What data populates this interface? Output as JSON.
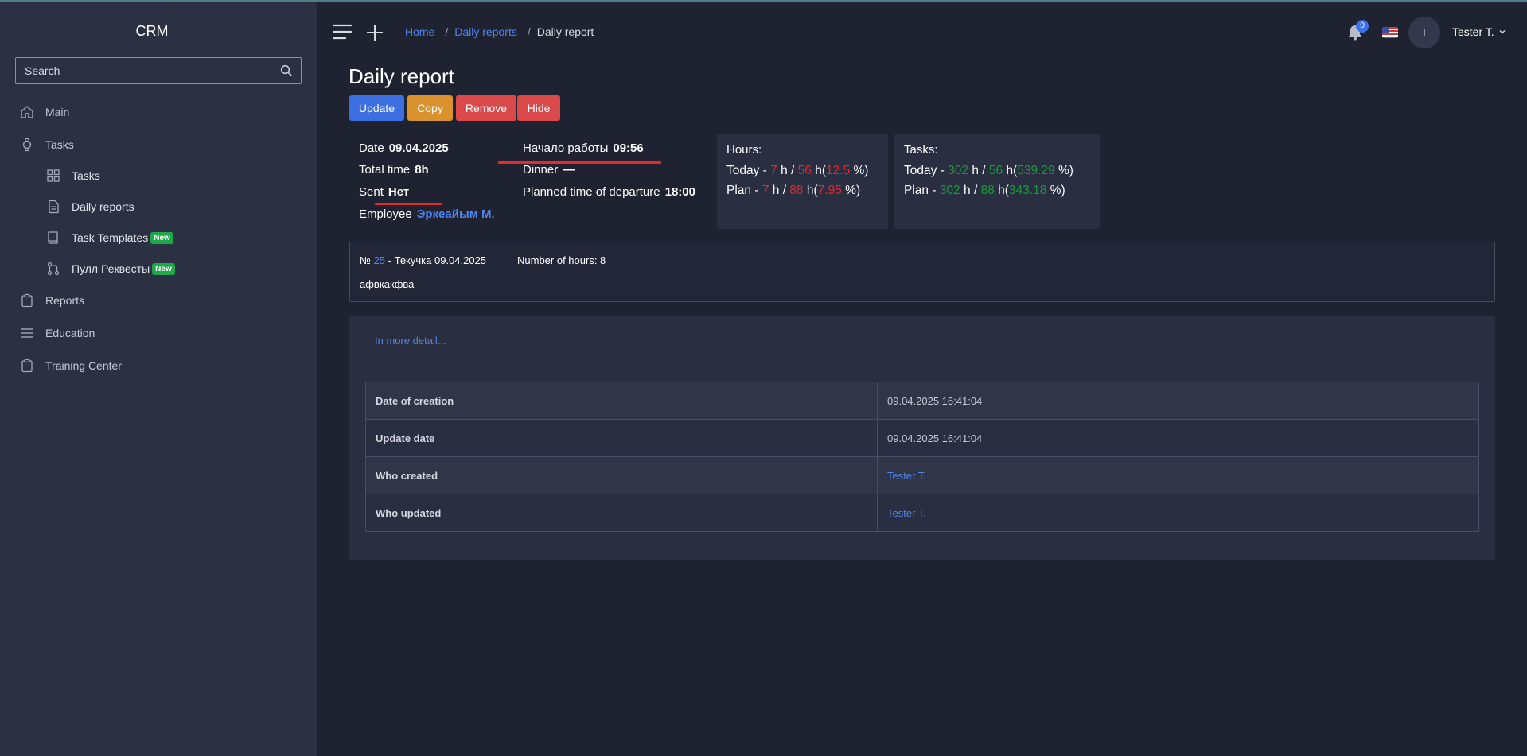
{
  "sidebar": {
    "brand": "CRM",
    "search_placeholder": "Search",
    "items": [
      {
        "label": "Main",
        "icon": "home-icon"
      },
      {
        "label": "Tasks",
        "icon": "watch-icon"
      },
      {
        "label": "Tasks",
        "icon": "grid-icon",
        "sub": true
      },
      {
        "label": "Daily reports",
        "icon": "document-icon",
        "sub": true
      },
      {
        "label": "Task Templates",
        "icon": "book-icon",
        "sub": true,
        "badge": "New"
      },
      {
        "label": "Пулл Реквесты",
        "icon": "pull-request-icon",
        "sub": true,
        "badge": "New"
      },
      {
        "label": "Reports",
        "icon": "clipboard-icon"
      },
      {
        "label": "Education",
        "icon": "list-icon"
      },
      {
        "label": "Training Center",
        "icon": "clipboard-icon"
      }
    ]
  },
  "header": {
    "breadcrumb": {
      "home": "Home",
      "parent": "Daily reports",
      "current": "Daily report"
    },
    "notifications_count": "0",
    "avatar_initial": "T",
    "username": "Tester T."
  },
  "page": {
    "title": "Daily report",
    "buttons": {
      "update": "Update",
      "copy": "Copy",
      "remove": "Remove",
      "hide": "Hide"
    }
  },
  "info": {
    "date_label": "Date",
    "date_value": "09.04.2025",
    "total_label": "Total time",
    "total_value": "8h",
    "sent_label": "Sent",
    "sent_value": "Нет",
    "employee_label": "Employee",
    "employee_value": "Эркеайым М.",
    "start_label": "Начало работы",
    "start_value": "09:56",
    "dinner_label": "Dinner",
    "dinner_value": "—",
    "departure_label": "Planned time of departure",
    "departure_value": "18:00"
  },
  "hours_card": {
    "title": "Hours:",
    "today": {
      "label": "Today -",
      "a": "7",
      "b": "56",
      "pct": "12.5"
    },
    "plan": {
      "label": "Plan -",
      "a": "7",
      "b": "88",
      "pct": "7.95"
    }
  },
  "tasks_card": {
    "title": "Tasks:",
    "today": {
      "label": "Today -",
      "a": "302",
      "b": "56",
      "pct": "539.29"
    },
    "plan": {
      "label": "Plan -",
      "a": "302",
      "b": "88",
      "pct": "343.18"
    }
  },
  "task": {
    "no_prefix": "№",
    "number": "25",
    "title": "- Текучка 09.04.2025",
    "hours": "Number of hours: 8",
    "description": "афвкакфва"
  },
  "details": {
    "more_link": "In more detail...",
    "rows": [
      {
        "key": "Date of creation",
        "value": "09.04.2025 16:41:04"
      },
      {
        "key": "Update date",
        "value": "09.04.2025 16:41:04"
      },
      {
        "key": "Who created",
        "value": "Tester T."
      },
      {
        "key": "Who updated",
        "value": "Tester T."
      }
    ]
  },
  "units": {
    "h": "h",
    "slash": "/",
    "open": "(",
    "close": "%)"
  }
}
